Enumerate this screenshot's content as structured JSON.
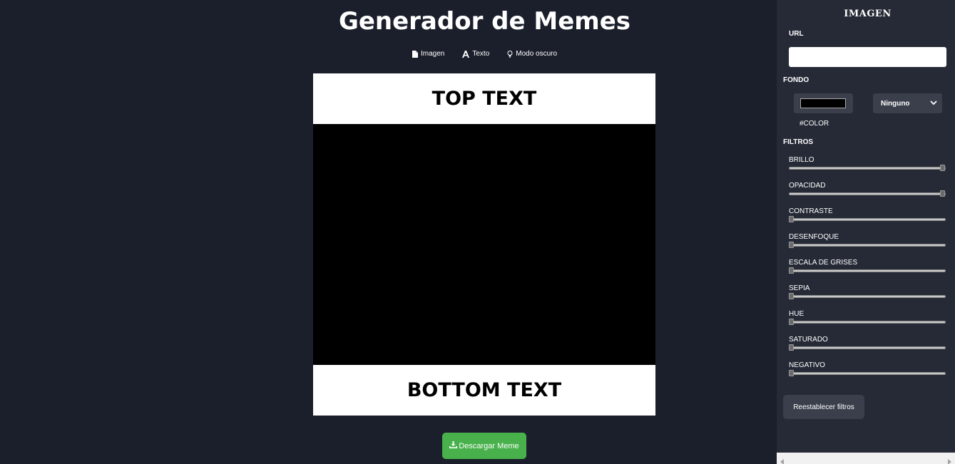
{
  "header": {
    "title": "Generador de Memes"
  },
  "nav": {
    "items": [
      {
        "label": "Imagen",
        "icon": "file-image-icon"
      },
      {
        "label": "Texto",
        "icon": "font-icon"
      },
      {
        "label": "Modo oscuro",
        "icon": "lightbulb-icon"
      }
    ]
  },
  "meme": {
    "top_text": "TOP TEXT",
    "bottom_text": "BOTTOM TEXT",
    "image_background": "#000000"
  },
  "download": {
    "label": "Descargar Meme",
    "icon": "download-icon",
    "color": "#48b14c"
  },
  "panel": {
    "title": "IMAGEN",
    "url_label": "URL",
    "url_value": "",
    "fondo_label": "FONDO",
    "color_value": "#000000",
    "color_code": "#COLOR",
    "blend_select": "Ninguno",
    "filtros_label": "FILTROS",
    "filters": [
      {
        "label": "BRILLO",
        "value": 1
      },
      {
        "label": "OPACIDAD",
        "value": 1
      },
      {
        "label": "CONTRASTE",
        "value": 0
      },
      {
        "label": "DESENFOQUE",
        "value": 0
      },
      {
        "label": "ESCALA DE GRISES",
        "value": 0
      },
      {
        "label": "SEPIA",
        "value": 0
      },
      {
        "label": "HUE",
        "value": 0
      },
      {
        "label": "SATURADO",
        "value": 0
      },
      {
        "label": "NEGATIVO",
        "value": 0
      }
    ],
    "reset_label": "Reestablecer filtros"
  },
  "colors": {
    "background": "#1b1f2b",
    "panel": "#252a36",
    "accent": "#48b14c"
  }
}
